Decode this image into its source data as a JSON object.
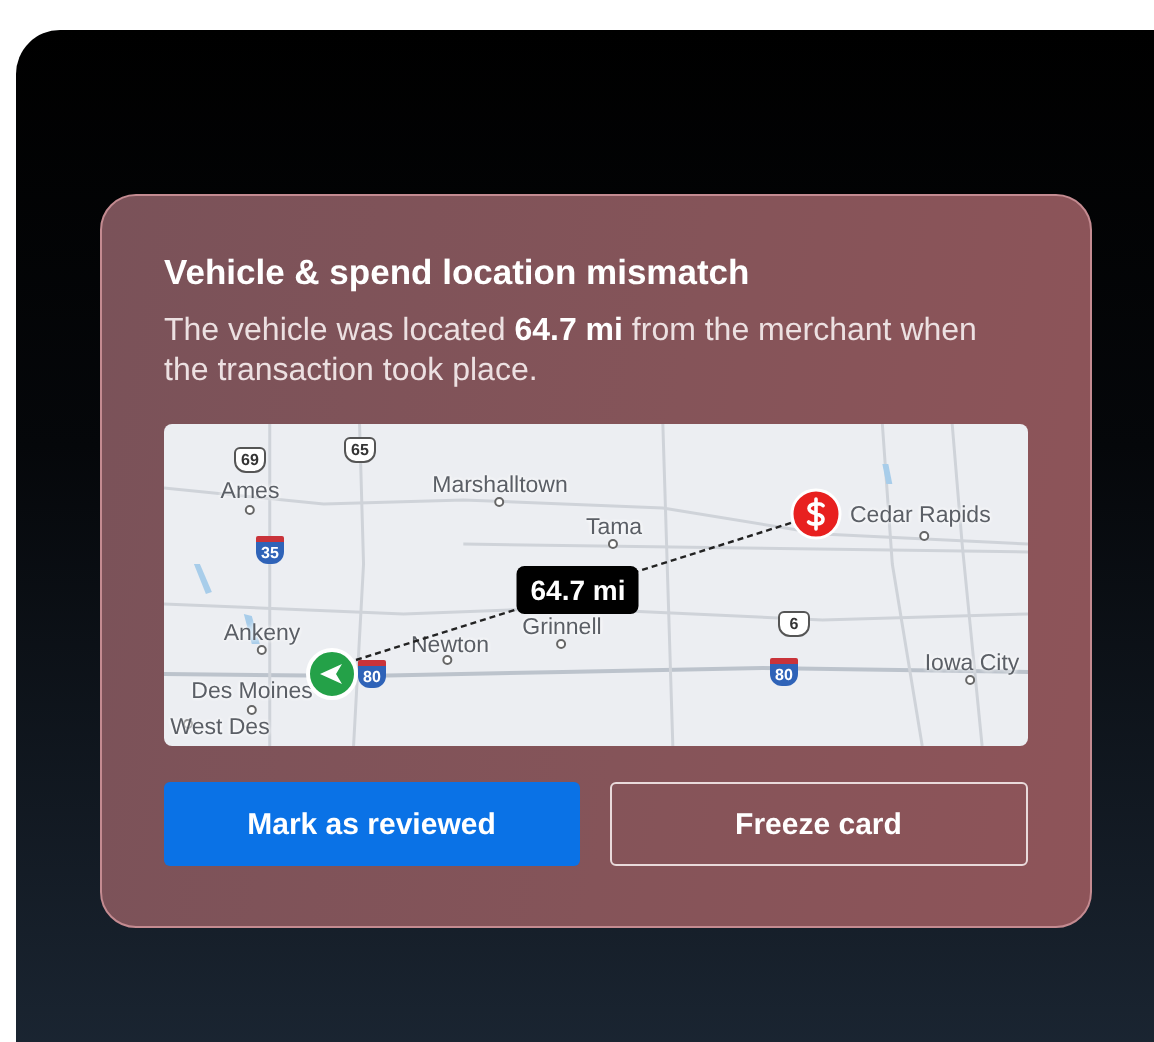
{
  "alert": {
    "title": "Vehicle & spend location mismatch",
    "message": "The vehicle was located **64.7 mi** from the merchant when the transaction took place."
  },
  "map": {
    "distance_label": "64.7 mi",
    "places": [
      {
        "name": "Ames"
      },
      {
        "name": "Marshalltown"
      },
      {
        "name": "Tama"
      },
      {
        "name": "Cedar Rapids"
      },
      {
        "name": "Ankeny"
      },
      {
        "name": "Newton"
      },
      {
        "name": "Grinnell"
      },
      {
        "name": "Iowa City"
      },
      {
        "name": "Des Moines"
      },
      {
        "name": "West Des"
      }
    ],
    "route_shields": [
      {
        "kind": "us",
        "label": "69"
      },
      {
        "kind": "us",
        "label": "65"
      },
      {
        "kind": "interstate",
        "label": "35"
      },
      {
        "kind": "us",
        "label": "6"
      },
      {
        "kind": "interstate",
        "label": "80"
      },
      {
        "kind": "interstate",
        "label": "80"
      }
    ]
  },
  "actions": [
    {
      "kind": "primary",
      "label": "Mark as reviewed"
    },
    {
      "kind": "secondary",
      "label": "Freeze card"
    }
  ]
}
